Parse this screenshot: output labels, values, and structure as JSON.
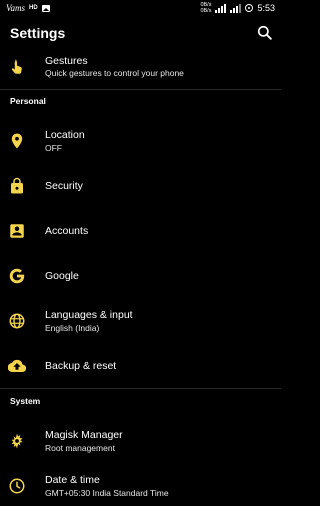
{
  "status_bar": {
    "carrier": "Vams",
    "hd": "HD",
    "speed_up": "0B/s",
    "speed_down": "0B/s",
    "time": "5:53"
  },
  "app_bar": {
    "title": "Settings",
    "search_icon": "search-icon"
  },
  "accent_color": "#f4d44d",
  "items": {
    "gestures": {
      "title": "Gestures",
      "subtitle": "Quick gestures to control your phone"
    },
    "location": {
      "title": "Location",
      "subtitle": "OFF"
    },
    "security": {
      "title": "Security"
    },
    "accounts": {
      "title": "Accounts"
    },
    "google": {
      "title": "Google"
    },
    "languages": {
      "title": "Languages & input",
      "subtitle": "English (India)"
    },
    "backup": {
      "title": "Backup & reset"
    },
    "magisk": {
      "title": "Magisk Manager",
      "subtitle": "Root management"
    },
    "datetime": {
      "title": "Date & time",
      "subtitle": "GMT+05:30 India Standard Time"
    }
  },
  "sections": {
    "personal": "Personal",
    "system": "System"
  }
}
